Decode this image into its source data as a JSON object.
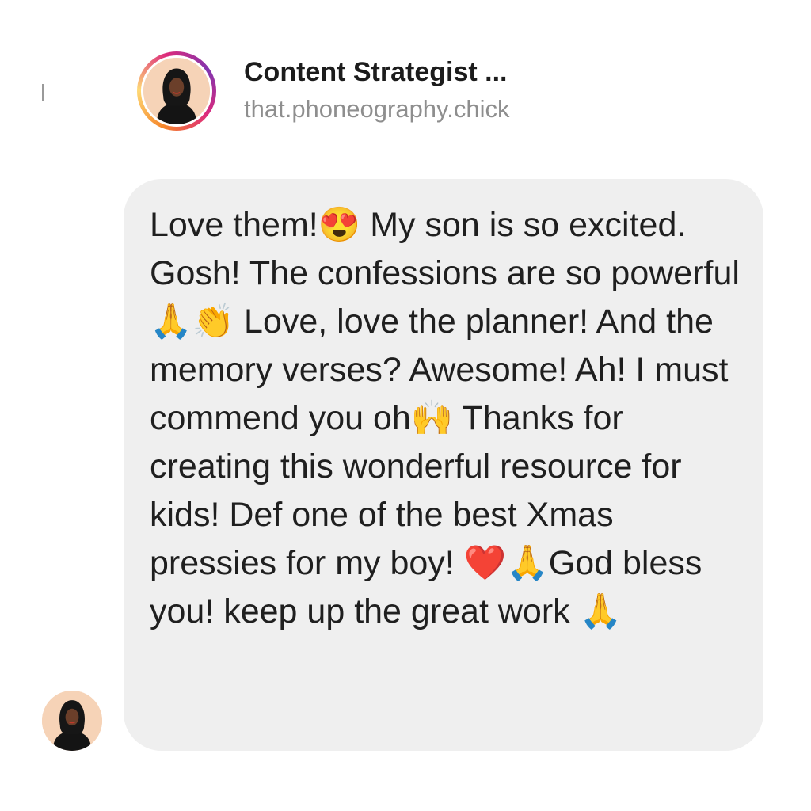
{
  "header": {
    "display_name": "Content Strategist ...",
    "username": "that.phoneography.chick",
    "avatar_icon": "profile-photo-avatar",
    "story_ring_colors": [
      "#f58529",
      "#feda77",
      "#dd2a7b",
      "#8134af"
    ]
  },
  "message": {
    "text": "Love them!😍 My son is so excited. Gosh! The confessions are so powerful 🙏👏 Love, love the planner! And the memory verses? Awesome! Ah! I must commend you oh🙌 Thanks for creating this wonderful resource for kids! Def one of the best Xmas pressies for my boy! ❤️🙏God bless you! keep up the great work 🙏",
    "bubble_color": "#efefef",
    "sender_avatar_icon": "profile-photo-avatar"
  }
}
